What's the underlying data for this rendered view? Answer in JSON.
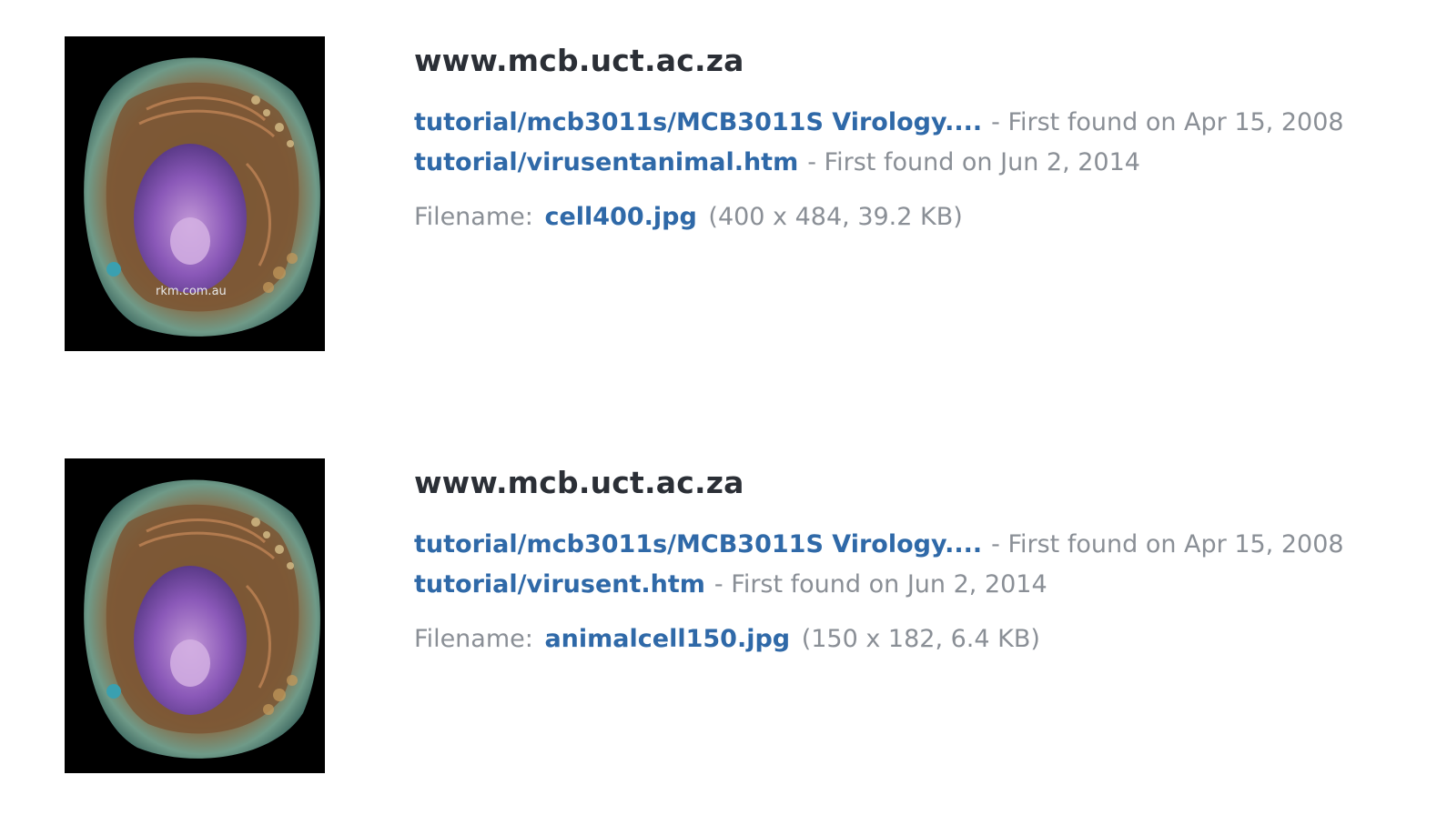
{
  "results": [
    {
      "domain": "www.mcb.uct.ac.za",
      "image_alt": "animal cell illustration",
      "watermark": "rkm.com.au",
      "backlinks": [
        {
          "url": "tutorial/mcb3011s/MCB3011S Virology....",
          "found": "- First found on Apr 15, 2008"
        },
        {
          "url": "tutorial/virusentanimal.htm",
          "found": "- First found on Jun 2, 2014"
        }
      ],
      "filename_label": "Filename:",
      "filename": "cell400.jpg",
      "fileinfo": "(400 x 484, 39.2 KB)"
    },
    {
      "domain": "www.mcb.uct.ac.za",
      "image_alt": "animal cell illustration",
      "watermark": "",
      "backlinks": [
        {
          "url": "tutorial/mcb3011s/MCB3011S Virology....",
          "found": "- First found on Apr 15, 2008"
        },
        {
          "url": "tutorial/virusent.htm",
          "found": "- First found on Jun 2, 2014"
        }
      ],
      "filename_label": "Filename:",
      "filename": "animalcell150.jpg",
      "fileinfo": "(150 x 182, 6.4 KB)"
    }
  ],
  "colors": {
    "link": "#2f69a8",
    "muted": "#8a8f96",
    "heading": "#2b2f36"
  }
}
